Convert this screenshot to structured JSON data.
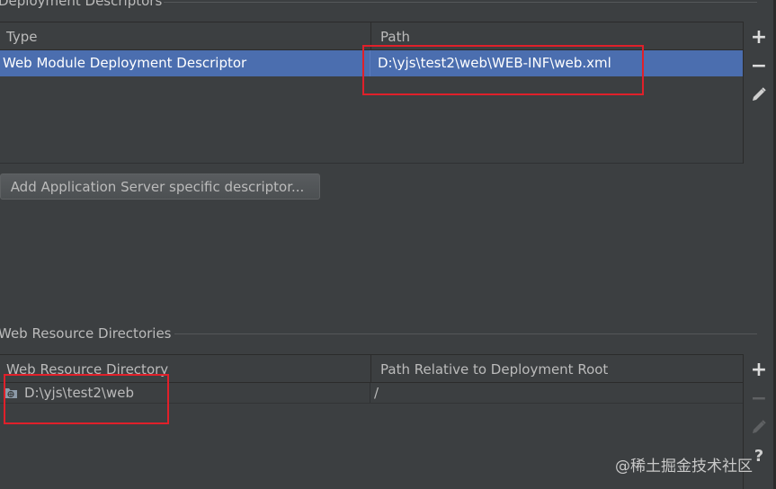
{
  "deployment": {
    "section_title": "Deployment Descriptors",
    "columns": [
      "Type",
      "Path"
    ],
    "rows": [
      {
        "type": "Web Module Deployment Descriptor",
        "path": "D:\\yjs\\test2\\web\\WEB-INF\\web.xml",
        "selected": true
      }
    ],
    "toolbar": {
      "add": "+",
      "remove": "−"
    }
  },
  "add_server_button_label": "Add Application Server specific descriptor...",
  "web_resources": {
    "section_title": "Web Resource Directories",
    "columns": [
      "Web Resource Directory",
      "Path Relative to Deployment Root"
    ],
    "rows": [
      {
        "directory": "D:\\yjs\\test2\\web",
        "relative_path": "/"
      }
    ],
    "toolbar": {
      "add": "+",
      "remove": "−",
      "help": "?"
    }
  },
  "watermark": "@稀土掘金技术社区",
  "colors": {
    "selection": "#4b6eaf",
    "annotation_red": "#e0202a",
    "background": "#3c3f41"
  }
}
